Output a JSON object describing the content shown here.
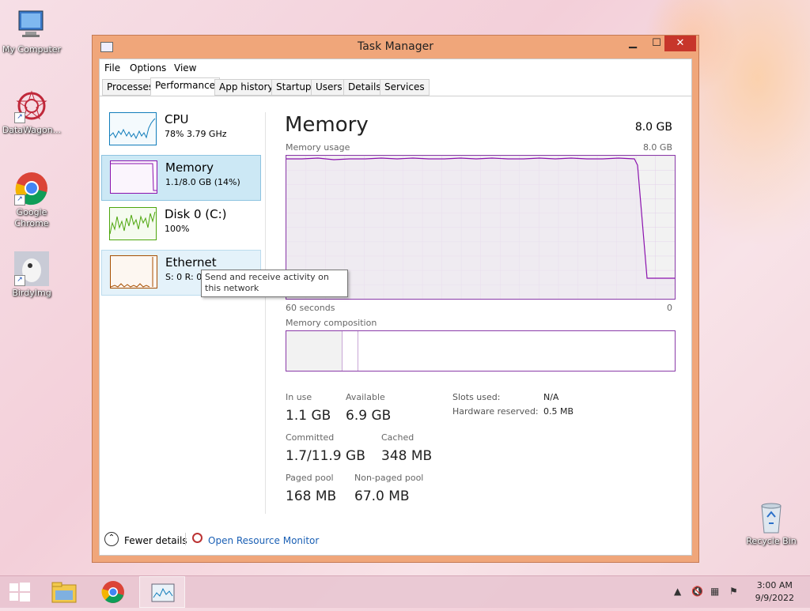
{
  "desktop": {
    "icons": [
      {
        "label": "My Computer"
      },
      {
        "label": "DataWagon..."
      },
      {
        "label": "Google Chrome"
      },
      {
        "label": "BirdyImg"
      },
      {
        "label": "Recycle Bin"
      }
    ]
  },
  "window": {
    "title": "Task Manager",
    "controls": {
      "minimize": "▁",
      "maximize": "☐",
      "close": "✕"
    },
    "menu": [
      "File",
      "Options",
      "View"
    ],
    "tabs": [
      "Processes",
      "Performance",
      "App history",
      "Startup",
      "Users",
      "Details",
      "Services"
    ],
    "active_tab": "Performance"
  },
  "sidebar": {
    "items": [
      {
        "name": "CPU",
        "sub": "78% 3.79 GHz",
        "color": "#117dbb"
      },
      {
        "name": "Memory",
        "sub": "1.1/8.0 GB (14%)",
        "color": "#8b12ae"
      },
      {
        "name": "Disk 0 (C:)",
        "sub": "100%",
        "color": "#4da60c"
      },
      {
        "name": "Ethernet",
        "sub": "S: 0 R: 0",
        "color": "#a74f01"
      }
    ]
  },
  "tooltip": {
    "text": "Send and receive activity on this network"
  },
  "memory": {
    "title": "Memory",
    "total": "8.0 GB",
    "usage_label": "Memory usage",
    "usage_max": "8.0 GB",
    "axis_left": "60 seconds",
    "axis_right": "0",
    "composition_label": "Memory composition",
    "stats": {
      "in_use_label": "In use",
      "in_use": "1.1 GB",
      "available_label": "Available",
      "available": "6.9 GB",
      "committed_label": "Committed",
      "committed": "1.7/11.9 GB",
      "cached_label": "Cached",
      "cached": "348 MB",
      "paged_label": "Paged pool",
      "paged": "168 MB",
      "nonpaged_label": "Non-paged pool",
      "nonpaged": "67.0 MB"
    },
    "details": {
      "slots_label": "Slots used:",
      "slots": "N/A",
      "hw_label": "Hardware reserved:",
      "hw": "0.5 MB"
    }
  },
  "footer": {
    "fewer": "Fewer details",
    "resource_monitor": "Open Resource Monitor"
  },
  "taskbar": {
    "time": "3:00 AM",
    "date": "9/9/2022"
  }
}
